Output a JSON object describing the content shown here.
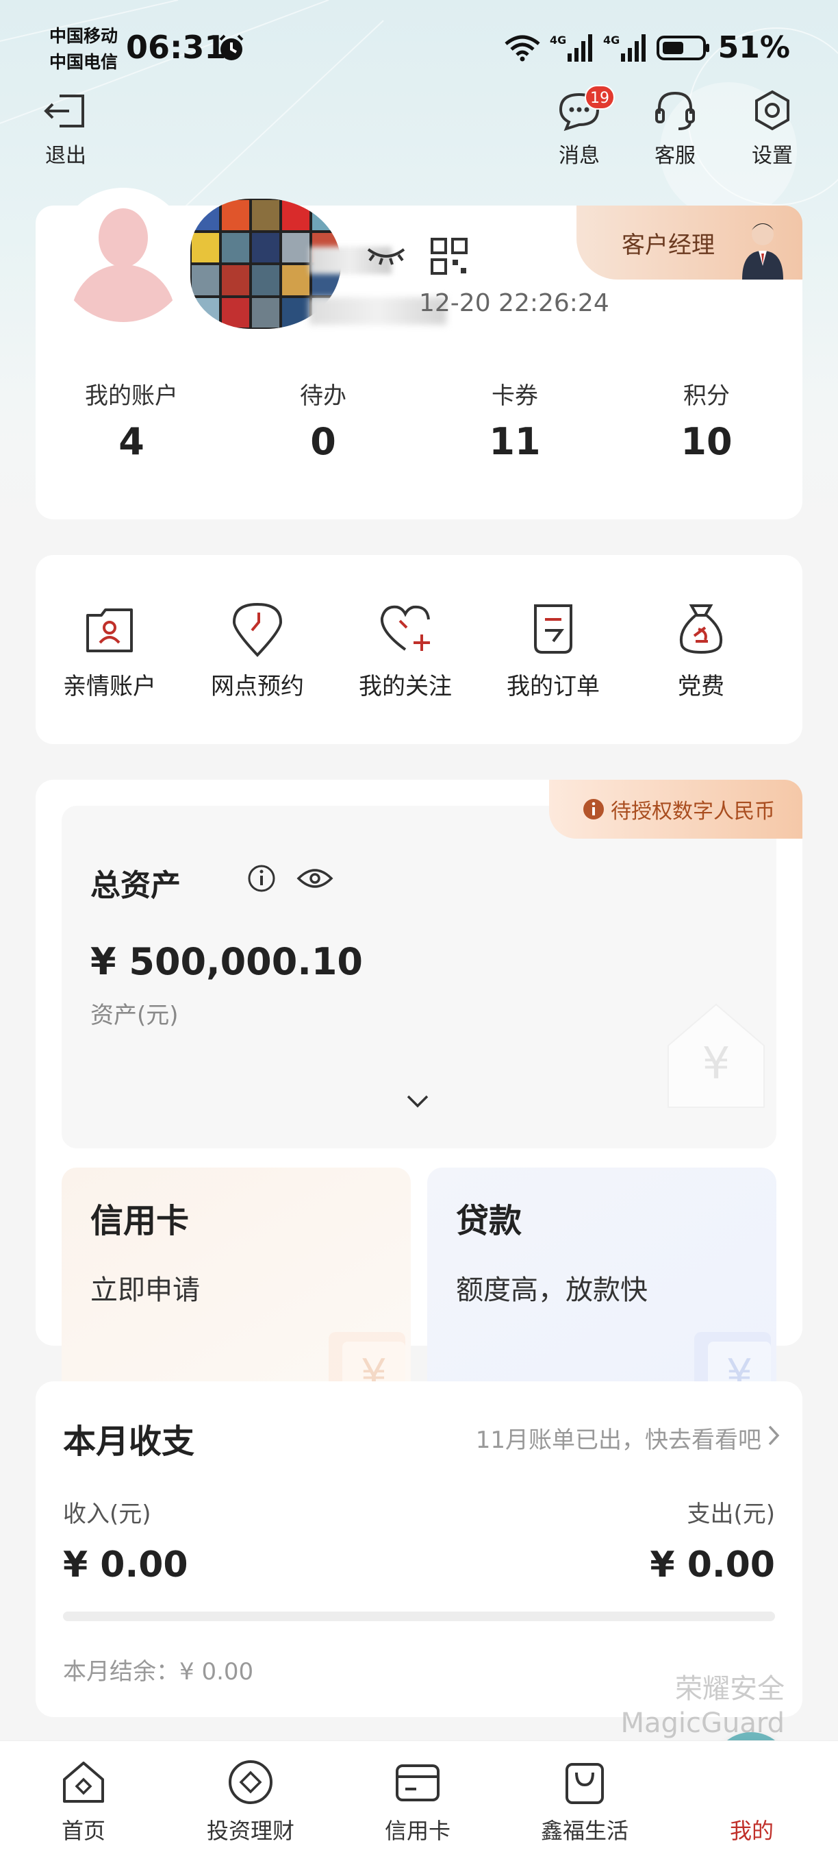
{
  "status_bar": {
    "carrier_1": "中国移动",
    "carrier_2": "中国电信",
    "time": "06:31",
    "battery": "51%",
    "network_1": "4G",
    "network_2": "4G"
  },
  "header": {
    "logout": "退出",
    "messages": "消息",
    "messages_badge": "19",
    "service": "客服",
    "settings": "设置"
  },
  "profile": {
    "login_time": "12-20 22:26:24",
    "manager_tab": "客户经理",
    "stats": [
      {
        "label": "我的账户",
        "value": "4"
      },
      {
        "label": "待办",
        "value": "0"
      },
      {
        "label": "卡券",
        "value": "11"
      },
      {
        "label": "积分",
        "value": "10"
      }
    ]
  },
  "quick_actions": [
    {
      "label": "亲情账户",
      "icon": "family-account-icon"
    },
    {
      "label": "网点预约",
      "icon": "location-pin-icon"
    },
    {
      "label": "我的关注",
      "icon": "heart-plus-icon"
    },
    {
      "label": "我的订单",
      "icon": "order-list-icon"
    },
    {
      "label": "党费",
      "icon": "party-dues-bag-icon"
    }
  ],
  "assets": {
    "dcep_tab": "待授权数字人民币",
    "title": "总资产",
    "amount": "¥ 500,000.10",
    "unit": "资产(元)"
  },
  "promos": {
    "credit_title": "信用卡",
    "credit_sub": "立即申请",
    "loan_title": "贷款",
    "loan_sub": "额度高，放款快"
  },
  "monthly": {
    "title": "本月收支",
    "bill_link": "11月账单已出，快去看看吧",
    "income_label": "收入(元)",
    "expense_label": "支出(元)",
    "income_value": "¥ 0.00",
    "expense_value": "¥ 0.00",
    "balance": "本月结余：¥ 0.00"
  },
  "watermark": {
    "line1": "荣耀安全",
    "line2": "MagicGuard"
  },
  "bottom_nav": [
    {
      "label": "首页"
    },
    {
      "label": "投资理财"
    },
    {
      "label": "信用卡"
    },
    {
      "label": "鑫福生活"
    },
    {
      "label": "我的"
    }
  ],
  "colors": {
    "accent_red": "#c0302a",
    "badge_red": "#e23a2f",
    "active_nav": "#4a9ba3"
  }
}
